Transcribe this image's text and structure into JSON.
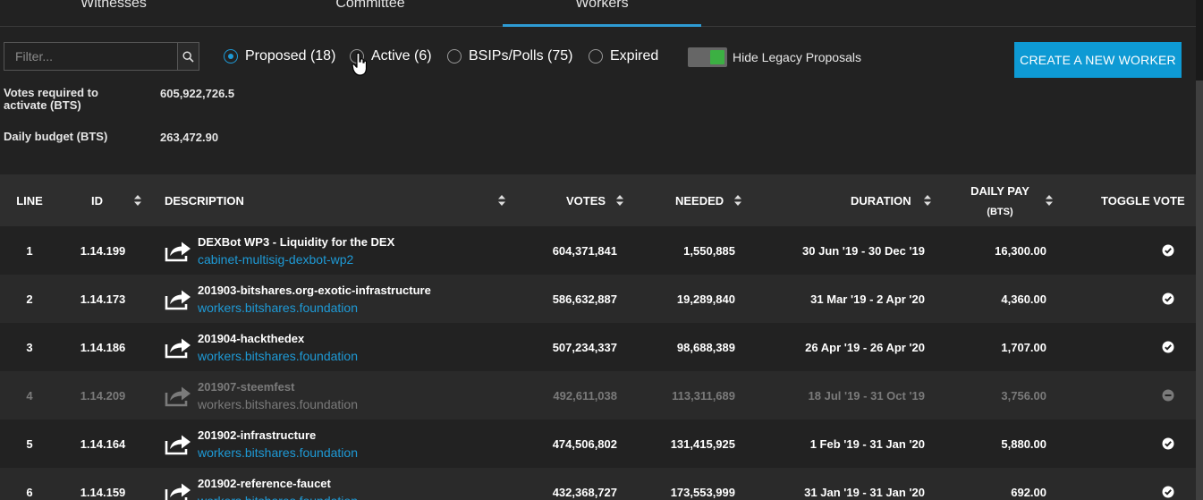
{
  "tabs": [
    {
      "label": "Witnesses",
      "active": false
    },
    {
      "label": "Committee",
      "active": false
    },
    {
      "label": "Workers",
      "active": true
    }
  ],
  "filter": {
    "placeholder": "Filter..."
  },
  "radios": [
    {
      "label": "Proposed (18)",
      "checked": true
    },
    {
      "label": "Active (6)",
      "checked": false
    },
    {
      "label": "BSIPs/Polls (75)",
      "checked": false
    },
    {
      "label": "Expired",
      "checked": false
    }
  ],
  "toggle": {
    "label": "Hide Legacy Proposals",
    "on": true
  },
  "create_button": "CREATE A NEW WORKER",
  "info": {
    "votes_required_label": "Votes required to activate (BTS)",
    "votes_required_value": "605,922,726.5",
    "daily_budget_label": "Daily budget (BTS)",
    "daily_budget_value": "263,472.90"
  },
  "table": {
    "headers": {
      "line": "LINE",
      "id": "ID",
      "description": "DESCRIPTION",
      "votes": "VOTES",
      "needed": "NEEDED",
      "duration": "DURATION",
      "daily_pay": "DAILY PAY",
      "daily_pay_unit": "(BTS)",
      "toggle": "TOGGLE VOTE"
    },
    "rows": [
      {
        "line": "1",
        "id": "1.14.199",
        "title": "DEXBot WP3 - Liquidity for the DEX",
        "link": "cabinet-multisig-dexbot-wp2",
        "votes": "604,371,841",
        "needed": "1,550,885",
        "duration": "30 Jun '19 - 30 Dec '19",
        "daily": "16,300.00",
        "voted": true,
        "dim": false
      },
      {
        "line": "2",
        "id": "1.14.173",
        "title": "201903-bitshares.org-exotic-infrastructure",
        "link": "workers.bitshares.foundation",
        "votes": "586,632,887",
        "needed": "19,289,840",
        "duration": "31 Mar '19 - 2 Apr '20",
        "daily": "4,360.00",
        "voted": true,
        "dim": false
      },
      {
        "line": "3",
        "id": "1.14.186",
        "title": "201904-hackthedex",
        "link": "workers.bitshares.foundation",
        "votes": "507,234,337",
        "needed": "98,688,389",
        "duration": "26 Apr '19 - 26 Apr '20",
        "daily": "1,707.00",
        "voted": true,
        "dim": false
      },
      {
        "line": "4",
        "id": "1.14.209",
        "title": "201907-steemfest",
        "link": "workers.bitshares.foundation",
        "votes": "492,611,038",
        "needed": "113,311,689",
        "duration": "18 Jul '19 - 31 Oct '19",
        "daily": "3,756.00",
        "voted": false,
        "dim": true
      },
      {
        "line": "5",
        "id": "1.14.164",
        "title": "201902-infrastructure",
        "link": "workers.bitshares.foundation",
        "votes": "474,506,802",
        "needed": "131,415,925",
        "duration": "1 Feb '19 - 31 Jan '20",
        "daily": "5,880.00",
        "voted": true,
        "dim": false
      },
      {
        "line": "6",
        "id": "1.14.159",
        "title": "201902-reference-faucet",
        "link": "workers.bitshares.foundation",
        "votes": "432,368,727",
        "needed": "173,553,999",
        "duration": "31 Jan '19 - 31 Jan '20",
        "daily": "692.00",
        "voted": true,
        "dim": false
      }
    ]
  },
  "colors": {
    "accent": "#1e9ad6",
    "button": "#0e9ad4",
    "toggle_on": "#3cb043",
    "background": "#222222"
  }
}
